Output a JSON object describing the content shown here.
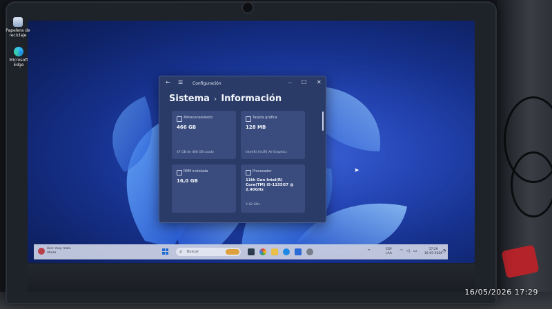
{
  "desktop": {
    "icons": [
      {
        "label": "Papelera de reciclaje"
      },
      {
        "label": "Microsoft Edge"
      }
    ]
  },
  "window": {
    "title": "Configuración",
    "breadcrumb": {
      "parent": "Sistema",
      "separator": "›",
      "current": "Información"
    },
    "controls": {
      "back": "←",
      "menu": "☰",
      "minimize": "—",
      "maximize": "☐",
      "close": "✕"
    },
    "cards": [
      {
        "title": "Almacenamiento",
        "value": "466 GB",
        "detail": "47 GB de 466 GB usado"
      },
      {
        "title": "Tarjeta gráfica",
        "value": "128 MB",
        "detail": "Intel(R) Iris(R) Xe Graphics"
      },
      {
        "title": "RAM instalada",
        "value": "16,0 GB",
        "detail": ""
      },
      {
        "title": "Procesador",
        "value": "11th Gen Intel(R) Core(TM) i5-1155G7 @ 2.40GHz",
        "detail": "2.42 GHz"
      }
    ]
  },
  "taskbar": {
    "weather": {
      "line1": "Aire: muy mala",
      "line2": "Ahora"
    },
    "search_placeholder": "Buscar",
    "tray": {
      "lang1": "ESP",
      "lang2": "LAA",
      "time": "17:29",
      "date": "16-05-2026"
    }
  },
  "photo_timestamp": "16/05/2026  17:29",
  "colors": {
    "accent": "#1f6fd6",
    "window_bg": "#2a3b67",
    "card_bg": "#3a4c7d"
  }
}
